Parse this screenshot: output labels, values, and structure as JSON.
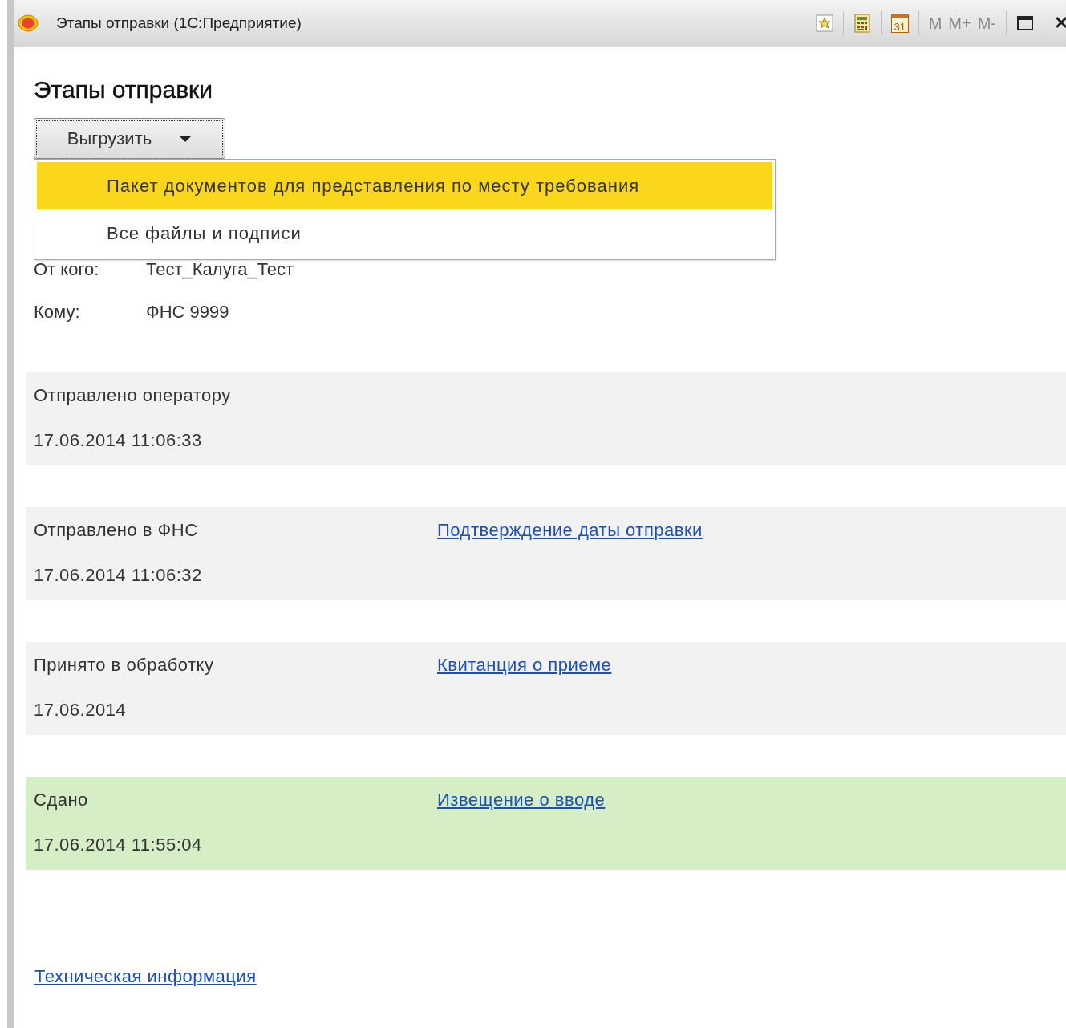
{
  "window": {
    "title": "Этапы отправки  (1С:Предприятие)",
    "tools": [
      {
        "kind": "favorite"
      },
      {
        "kind": "calculator"
      },
      {
        "kind": "calendar",
        "text": "31"
      },
      {
        "kind": "memory",
        "text": "M",
        "disabled": true
      },
      {
        "kind": "memory",
        "text": "M+",
        "disabled": true
      },
      {
        "kind": "memory",
        "text": "M-",
        "disabled": true
      },
      {
        "kind": "maximize"
      },
      {
        "kind": "close",
        "text": "✕"
      }
    ]
  },
  "heading": "Этапы отправки",
  "export_button": {
    "label": "Выгрузить",
    "expanded": true,
    "menu": [
      {
        "label": "Пакет документов для представления по месту требования",
        "selected": true
      },
      {
        "label": "Все файлы и подписи",
        "selected": false
      }
    ]
  },
  "fields": [
    {
      "label": "От кого:",
      "value": "Тест_Калуга_Тест"
    },
    {
      "label": "Кому:",
      "value": "ФНС 9999"
    }
  ],
  "stages": [
    {
      "name": "Отправлено оператору",
      "date": "17.06.2014 11:06:33",
      "done": false
    },
    {
      "name": "Отправлено в ФНС",
      "date": "17.06.2014 11:06:32",
      "link": "Подтверждение даты отправки",
      "done": false
    },
    {
      "name": "Принято в обработку",
      "date": "17.06.2014",
      "link": "Квитанция о приеме",
      "done": false
    },
    {
      "name": "Сдано",
      "date": "17.06.2014 11:55:04",
      "link": "Извещение о вводе",
      "done": true
    }
  ],
  "footer_link": "Техническая информация"
}
